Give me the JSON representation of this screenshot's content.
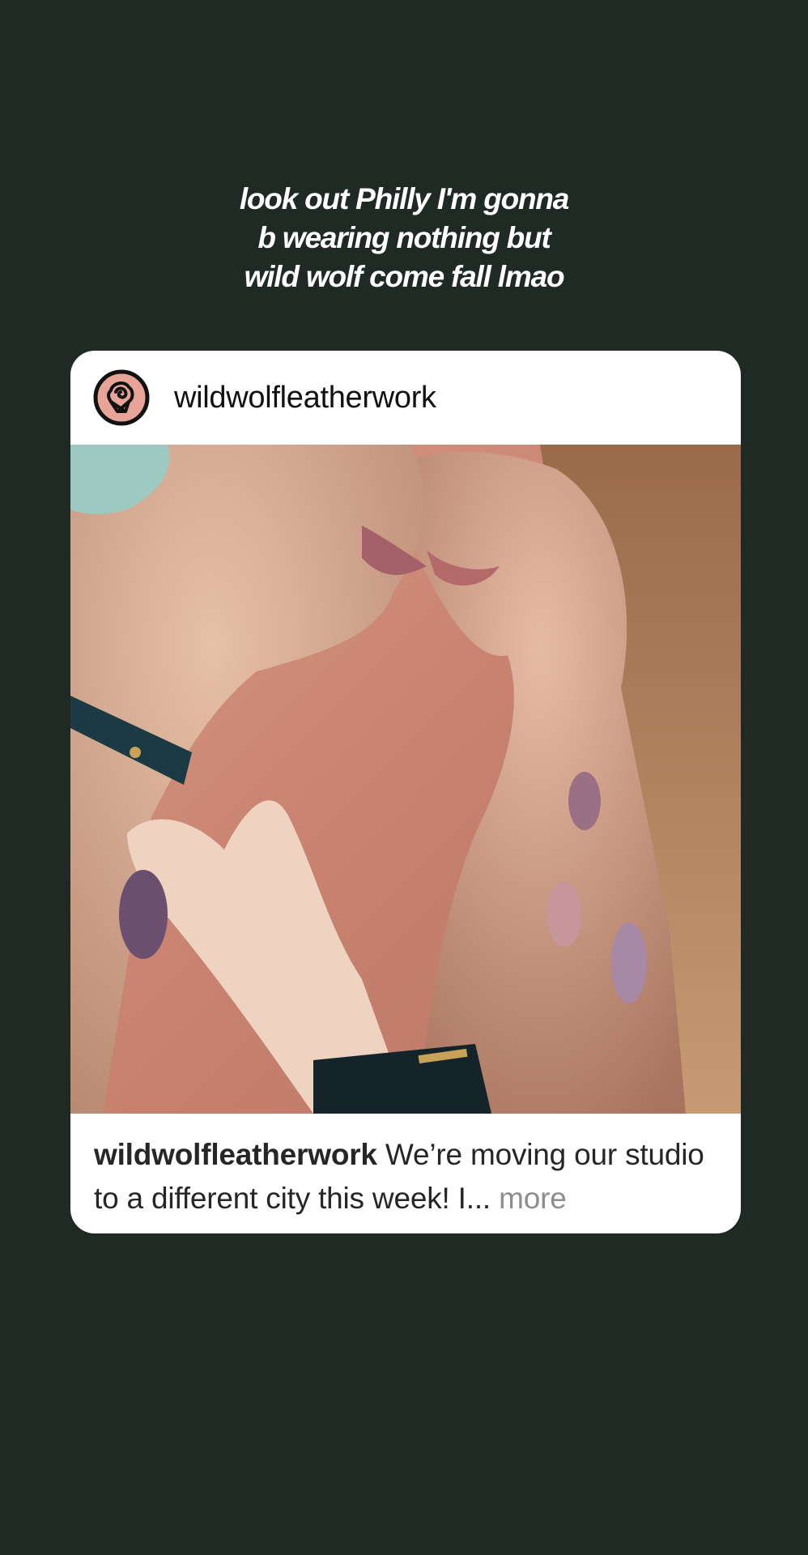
{
  "story": {
    "text_lines": [
      "look out Philly I'm gonna",
      "b wearing nothing but",
      "wild wolf come fall lmao"
    ]
  },
  "post": {
    "username": "wildwolfleatherwork",
    "avatar_icon": "rose-logo-icon",
    "caption_user": "wildwolfleatherwork",
    "caption_text": "We’re moving our studio to a different city this week! I",
    "caption_ellipsis": "...",
    "more_label": "more",
    "image_description_icon": "photo"
  },
  "colors": {
    "background": "#1f2a25",
    "card": "#ffffff",
    "avatar_fill": "#e8a497",
    "more_text": "#8e8e8e"
  }
}
